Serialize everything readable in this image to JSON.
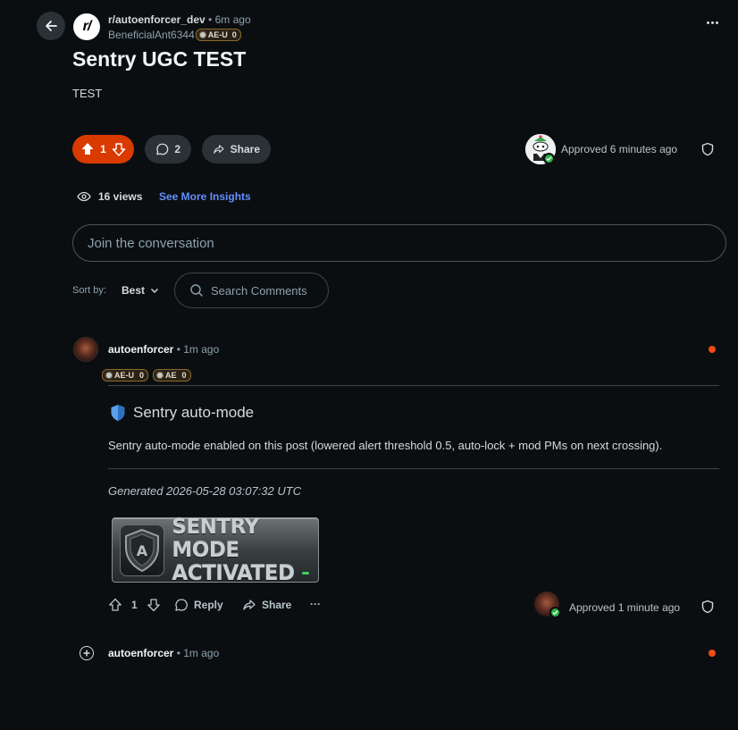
{
  "header": {
    "subreddit": "r/autoenforcer_dev",
    "subreddit_avatar_text": "r/",
    "separator": "•",
    "time": "6m ago",
    "author": "BeneficialAnt6344",
    "author_flair": {
      "label": "AE-U",
      "count": "0"
    }
  },
  "post": {
    "title": "Sentry UGC TEST",
    "body": "TEST"
  },
  "actions": {
    "vote_count": "1",
    "comment_count": "2",
    "share_label": "Share",
    "approved_text": "Approved 6 minutes ago",
    "views": "16 views",
    "insights_label": "See More Insights"
  },
  "join": {
    "placeholder": "Join the conversation"
  },
  "sort": {
    "label": "Sort by:",
    "value": "Best",
    "search_placeholder": "Search Comments"
  },
  "comments": [
    {
      "author": "autoenforcer",
      "separator": "•",
      "time": "1m ago",
      "flairs": [
        {
          "label": "AE-U",
          "count": "0"
        },
        {
          "label": "AE",
          "count": "0"
        }
      ],
      "heading": "Sentry auto-mode",
      "text": "Sentry auto-mode enabled on this post (lowered alert threshold 0.5, auto-lock + mod PMs on next crossing).",
      "generated": "Generated 2026-05-28 03:07:32 UTC",
      "banner": {
        "line1": "SENTRY MODE",
        "line2": "ACTIVATED",
        "shield_letter": "A"
      },
      "vote_count": "1",
      "reply_label": "Reply",
      "share_label": "Share",
      "more_label": "···",
      "approved_text": "Approved 1 minute ago"
    },
    {
      "author": "autoenforcer",
      "separator": "•",
      "time": "1m ago"
    }
  ],
  "colors": {
    "background": "#0b0e11",
    "upvote_accent": "#d93a00",
    "link_blue": "#648efc",
    "unread_dot": "#f04a1a",
    "approved_green": "#2fb24a"
  }
}
